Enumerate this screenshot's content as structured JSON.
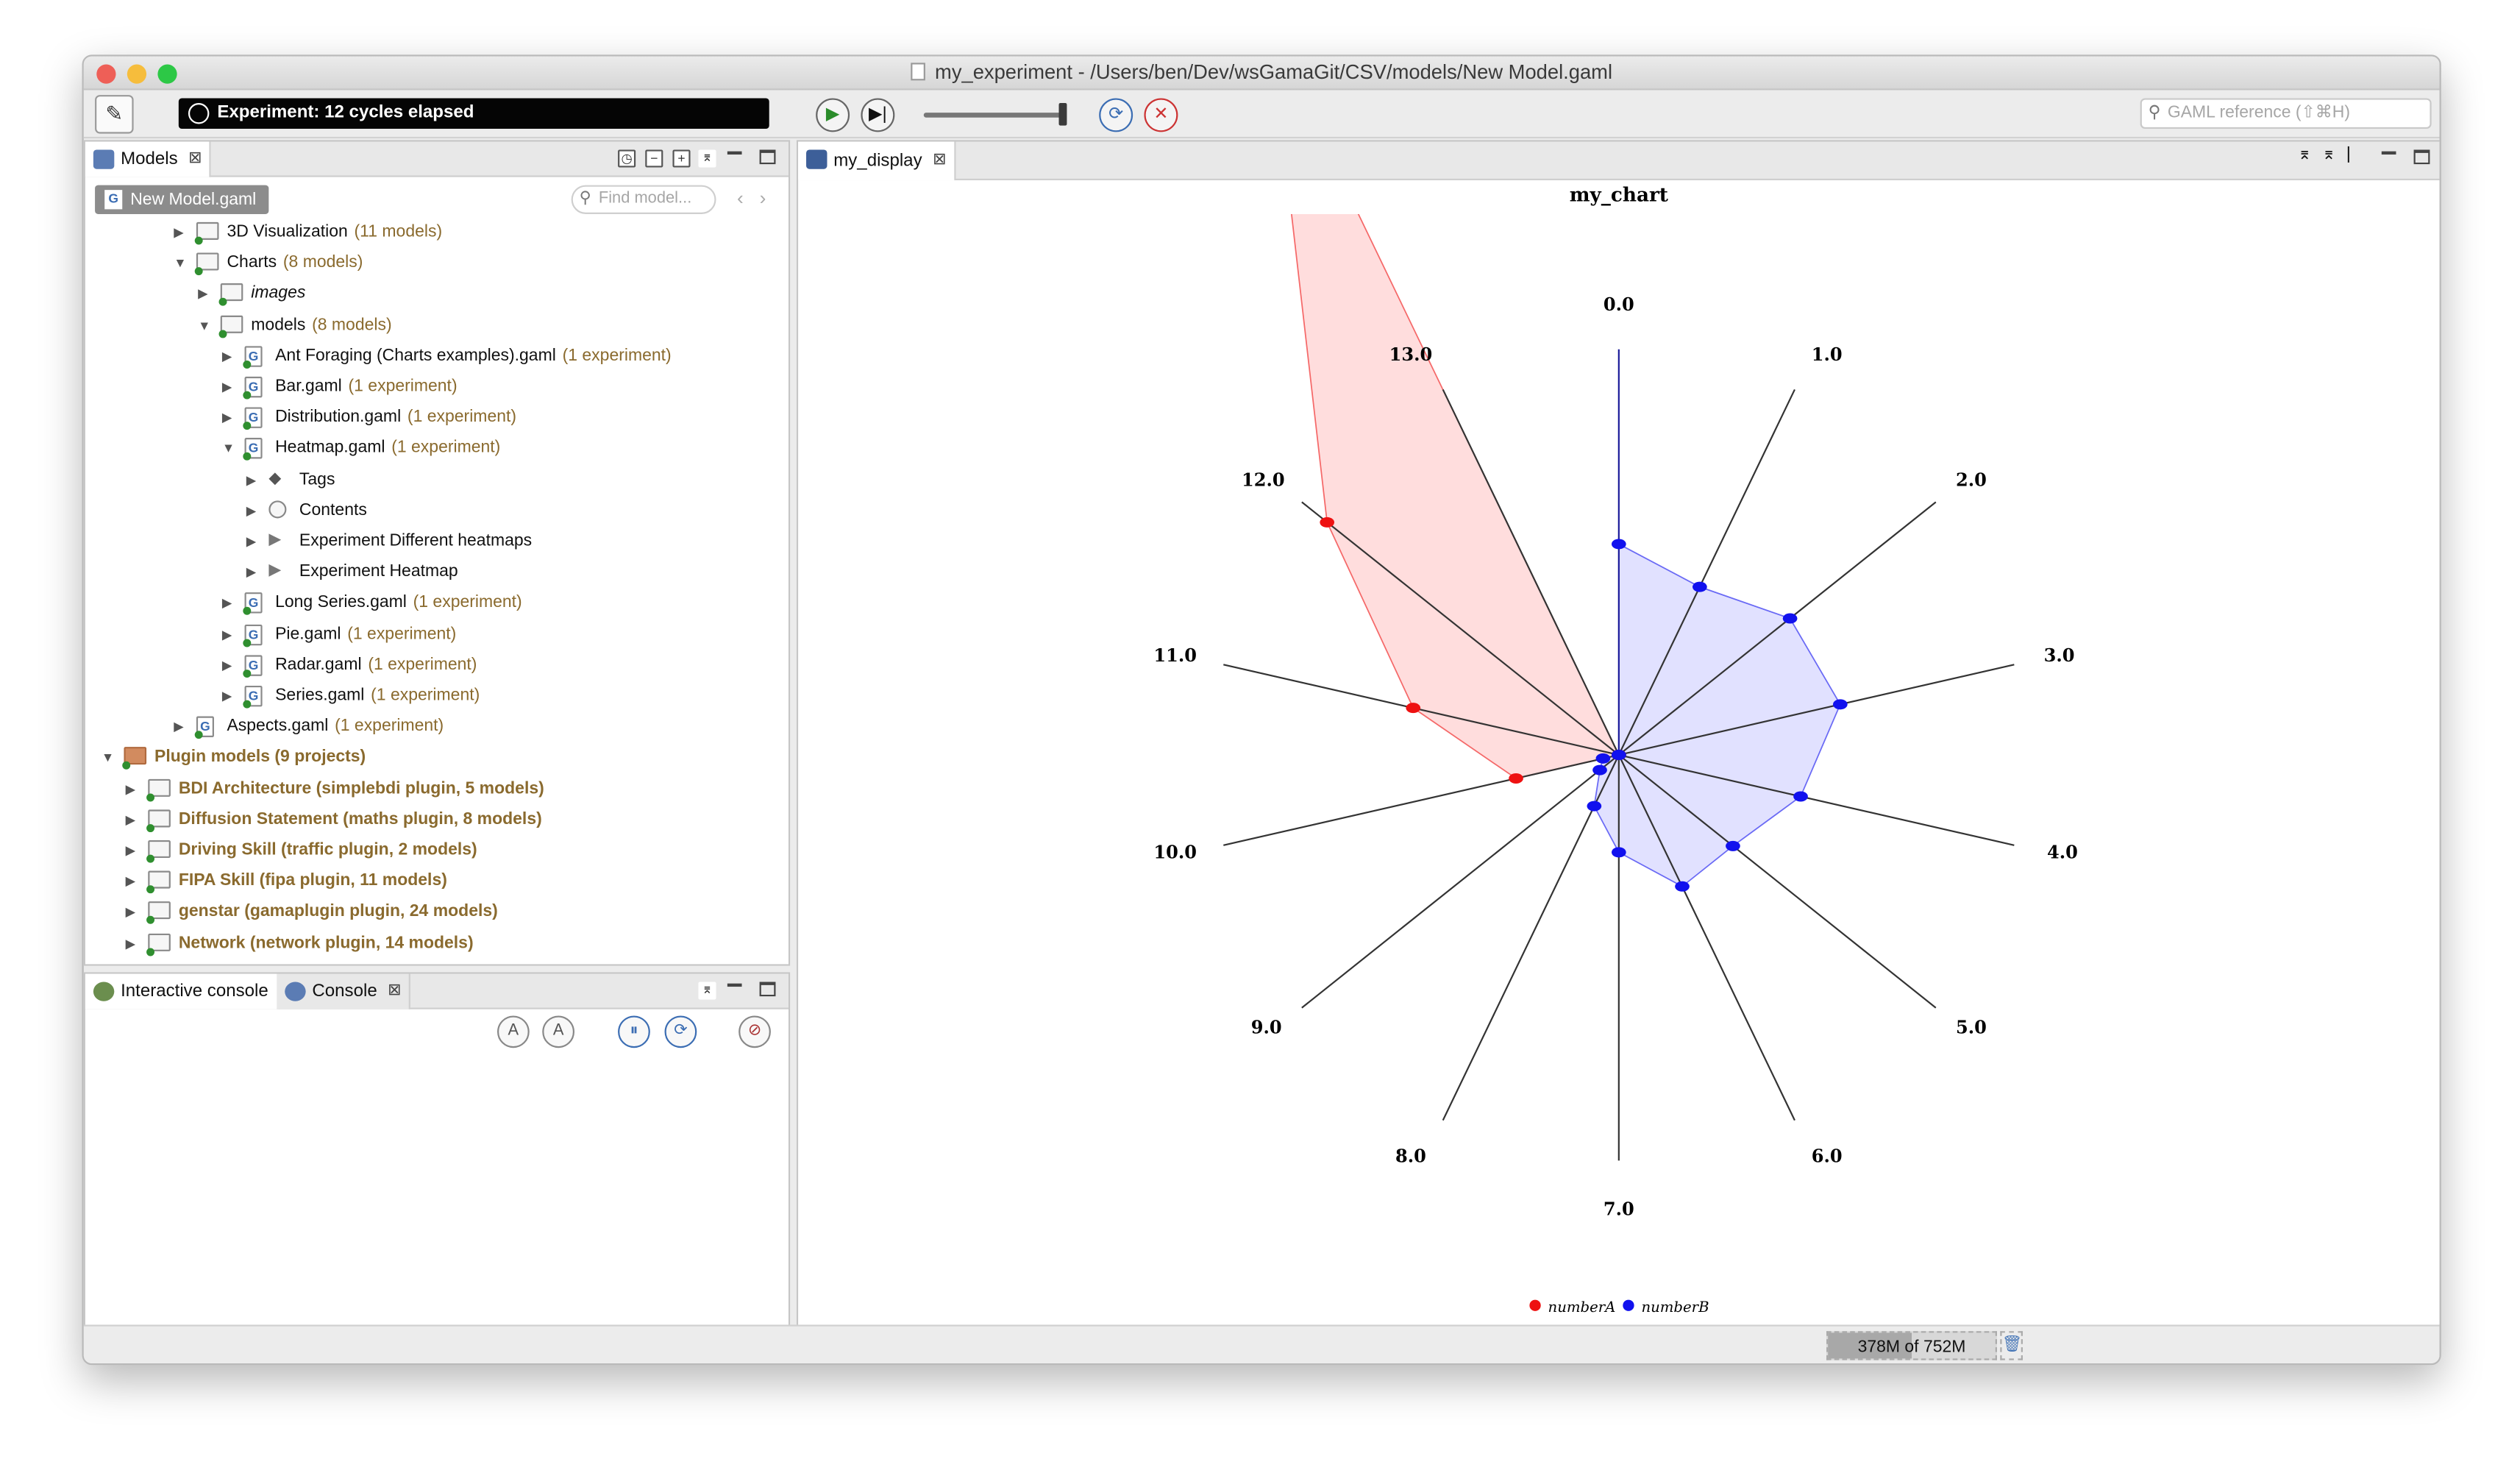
{
  "window": {
    "title": "my_experiment - /Users/ben/Dev/wsGamaGit/CSV/models/New Model.gaml",
    "traffic_lights": {
      "close": "#ee5f57",
      "minimize": "#f6bd3c",
      "maximize": "#2dc846"
    }
  },
  "toolbar": {
    "edit_icon": "pencil-icon",
    "experiment_status": "Experiment: 12 cycles elapsed",
    "speed_fraction": 1.0,
    "search_placeholder": "GAML reference (⇧⌘H)"
  },
  "models_view": {
    "tab_label": "Models",
    "selected_badge": "New Model.gaml",
    "find_placeholder": "Find model...",
    "rows": [
      {
        "indent": 3,
        "twisty": "▶",
        "icon": "folder",
        "label": "3D Visualization",
        "meta": "(11 models)"
      },
      {
        "indent": 3,
        "twisty": "▼",
        "icon": "folder",
        "label": "Charts",
        "meta": "(8 models)"
      },
      {
        "indent": 4,
        "twisty": "▶",
        "icon": "folder",
        "label": "images",
        "meta": "",
        "italic": true
      },
      {
        "indent": 4,
        "twisty": "▼",
        "icon": "folder",
        "label": "models",
        "meta": "(8 models)"
      },
      {
        "indent": 5,
        "twisty": "▶",
        "icon": "gaml",
        "label": "Ant Foraging (Charts examples).gaml",
        "meta": "(1 experiment)"
      },
      {
        "indent": 5,
        "twisty": "▶",
        "icon": "gaml",
        "label": "Bar.gaml",
        "meta": "(1 experiment)"
      },
      {
        "indent": 5,
        "twisty": "▶",
        "icon": "gaml",
        "label": "Distribution.gaml",
        "meta": "(1 experiment)"
      },
      {
        "indent": 5,
        "twisty": "▼",
        "icon": "gaml",
        "label": "Heatmap.gaml",
        "meta": "(1 experiment)"
      },
      {
        "indent": 6,
        "twisty": "▶",
        "icon": "tag",
        "label": "Tags",
        "meta": ""
      },
      {
        "indent": 6,
        "twisty": "▶",
        "icon": "globe",
        "label": "Contents",
        "meta": ""
      },
      {
        "indent": 6,
        "twisty": "▶",
        "icon": "play",
        "label": "Experiment Different heatmaps",
        "meta": ""
      },
      {
        "indent": 6,
        "twisty": "▶",
        "icon": "play",
        "label": "Experiment Heatmap",
        "meta": ""
      },
      {
        "indent": 5,
        "twisty": "▶",
        "icon": "gaml",
        "label": "Long Series.gaml",
        "meta": "(1 experiment)"
      },
      {
        "indent": 5,
        "twisty": "▶",
        "icon": "gaml",
        "label": "Pie.gaml",
        "meta": "(1 experiment)"
      },
      {
        "indent": 5,
        "twisty": "▶",
        "icon": "gaml",
        "label": "Radar.gaml",
        "meta": "(1 experiment)"
      },
      {
        "indent": 5,
        "twisty": "▶",
        "icon": "gaml",
        "label": "Series.gaml",
        "meta": "(1 experiment)"
      },
      {
        "indent": 3,
        "twisty": "▶",
        "icon": "gaml",
        "label": "Aspects.gaml",
        "meta": "(1 experiment)"
      },
      {
        "indent": 0,
        "twisty": "▼",
        "icon": "plugin",
        "label": "",
        "meta": "Plugin models (9 projects)",
        "boldmeta": true
      },
      {
        "indent": 1,
        "twisty": "▶",
        "icon": "folder",
        "label": "",
        "meta": "BDI Architecture (simplebdi plugin, 5 models)",
        "boldmeta": true
      },
      {
        "indent": 1,
        "twisty": "▶",
        "icon": "folder",
        "label": "",
        "meta": "Diffusion Statement (maths plugin, 8 models)",
        "boldmeta": true
      },
      {
        "indent": 1,
        "twisty": "▶",
        "icon": "folder",
        "label": "",
        "meta": "Driving Skill (traffic plugin, 2 models)",
        "boldmeta": true
      },
      {
        "indent": 1,
        "twisty": "▶",
        "icon": "folder",
        "label": "",
        "meta": "FIPA Skill (fipa plugin, 11 models)",
        "boldmeta": true
      },
      {
        "indent": 1,
        "twisty": "▶",
        "icon": "folder",
        "label": "",
        "meta": "genstar (gamaplugin plugin, 24 models)",
        "boldmeta": true
      },
      {
        "indent": 1,
        "twisty": "▶",
        "icon": "folder",
        "label": "",
        "meta": "Network (network plugin, 14 models)",
        "boldmeta": true
      }
    ]
  },
  "console_view": {
    "tabs": [
      "Interactive console",
      "Console"
    ]
  },
  "display_view": {
    "tab_label": "my_display"
  },
  "status": {
    "memory": "378M of 752M",
    "memory_used_fraction": 0.5
  },
  "chart_data": {
    "type": "radar",
    "title": "my_chart",
    "axes": [
      "0.0",
      "1.0",
      "2.0",
      "3.0",
      "4.0",
      "5.0",
      "6.0",
      "7.0",
      "8.0",
      "9.0",
      "10.0",
      "11.0",
      "12.0",
      "13.0"
    ],
    "rmax": 50,
    "series": [
      {
        "name": "numberA",
        "color": "#ee1111",
        "fill": "rgba(255,120,120,0.25)",
        "values": [
          0,
          0,
          0,
          0,
          0,
          0,
          0,
          0,
          0,
          0,
          13,
          26,
          46,
          99
        ]
      },
      {
        "name": "numberB",
        "color": "#1111ee",
        "fill": "rgba(120,120,255,0.22)",
        "values": [
          26,
          23,
          27,
          28,
          23,
          18,
          18,
          12,
          7,
          3,
          2,
          0,
          0,
          0
        ]
      }
    ],
    "legend_position": "bottom"
  }
}
